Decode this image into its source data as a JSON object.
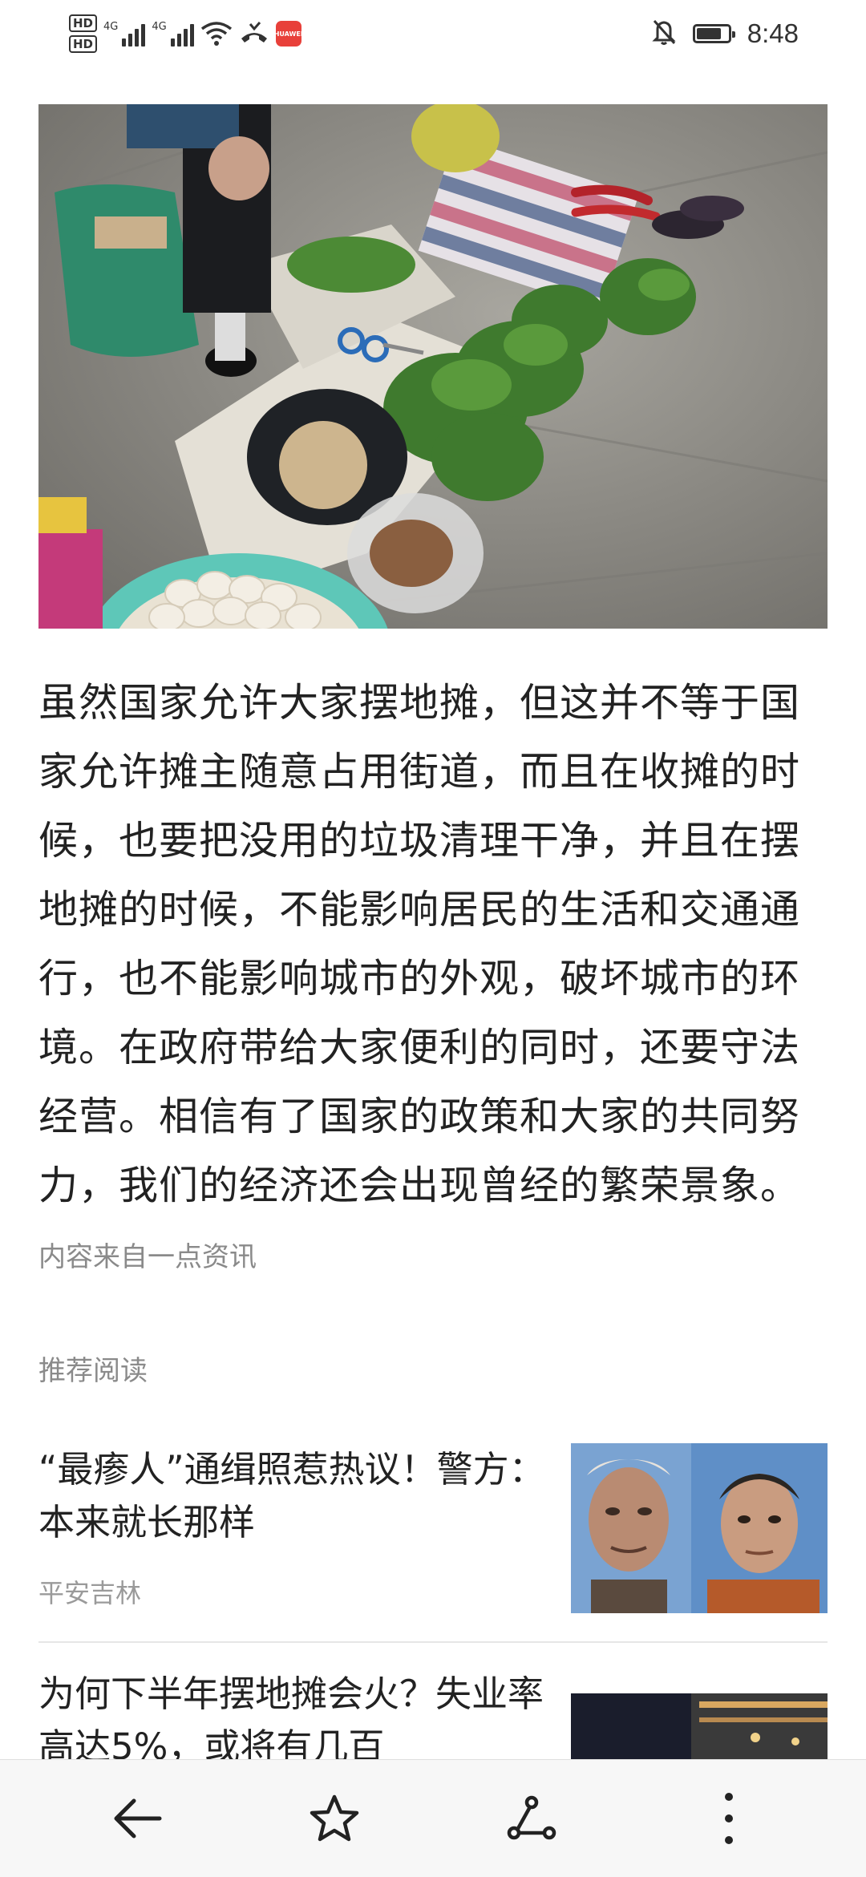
{
  "status_bar": {
    "hd1": "HD",
    "hd2": "HD",
    "net1": "4G",
    "net2": "4G",
    "app_badge": "HUAWEI",
    "time": "8:48",
    "battery_level": 0.8
  },
  "article": {
    "body": "虽然国家允许大家摆地摊，但这并不等于国家允许摊主随意占用街道，而且在收摊的时候，也要把没用的垃圾清理干净，并且在摆地摊的时候，不能影响居民的生活和交通通行，也不能影响城市的外观，破坏城市的环境。在政府带给大家便利的同时，还要守法经营。相信有了国家的政策和大家的共同努力，我们的经济还会出现曾经的繁荣景象。",
    "source": "内容来自一点资讯"
  },
  "recommended": {
    "heading": "推荐阅读",
    "items": [
      {
        "title": "“最瘆人”通缉照惹热议！警方：本来就长那样",
        "source": "平安吉林"
      },
      {
        "title": "为何下半年摆地摊会火？失业率高达5%，或将有几百",
        "source": ""
      }
    ]
  },
  "bottom_bar": {
    "icons": [
      "back-arrow-icon",
      "star-icon",
      "share-icon",
      "more-vertical-icon"
    ]
  }
}
